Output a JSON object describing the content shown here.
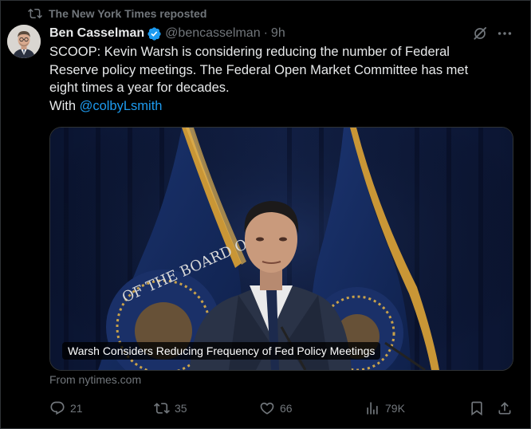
{
  "repost": {
    "text": "The New York Times reposted",
    "icon": "repost-icon"
  },
  "author": {
    "name": "Ben Casselman",
    "handle": "@bencasselman",
    "separator": "·",
    "time": "9h",
    "verified_color": "#1d9bf0"
  },
  "tweet": {
    "line1": "SCOOP: Kevin Warsh is considering reducing the number of Federal",
    "line2": "Reserve policy meetings. The Federal Open Market Committee has met",
    "line3": "eight times a year for decades.",
    "with_prefix": "With",
    "mention": "@colbyLsmith"
  },
  "media": {
    "caption": "Warsh Considers Reducing Frequency of Fed Policy Meetings",
    "seal_text": "OF THE BOARD OF GO"
  },
  "link_source": "From nytimes.com",
  "actions": {
    "replies": "21",
    "reposts": "35",
    "likes": "66",
    "views": "79K"
  },
  "colors": {
    "background": "#000000",
    "text": "#e7e9ea",
    "secondary": "#71767b",
    "accent": "#1d9bf0",
    "border": "#2f3336"
  }
}
